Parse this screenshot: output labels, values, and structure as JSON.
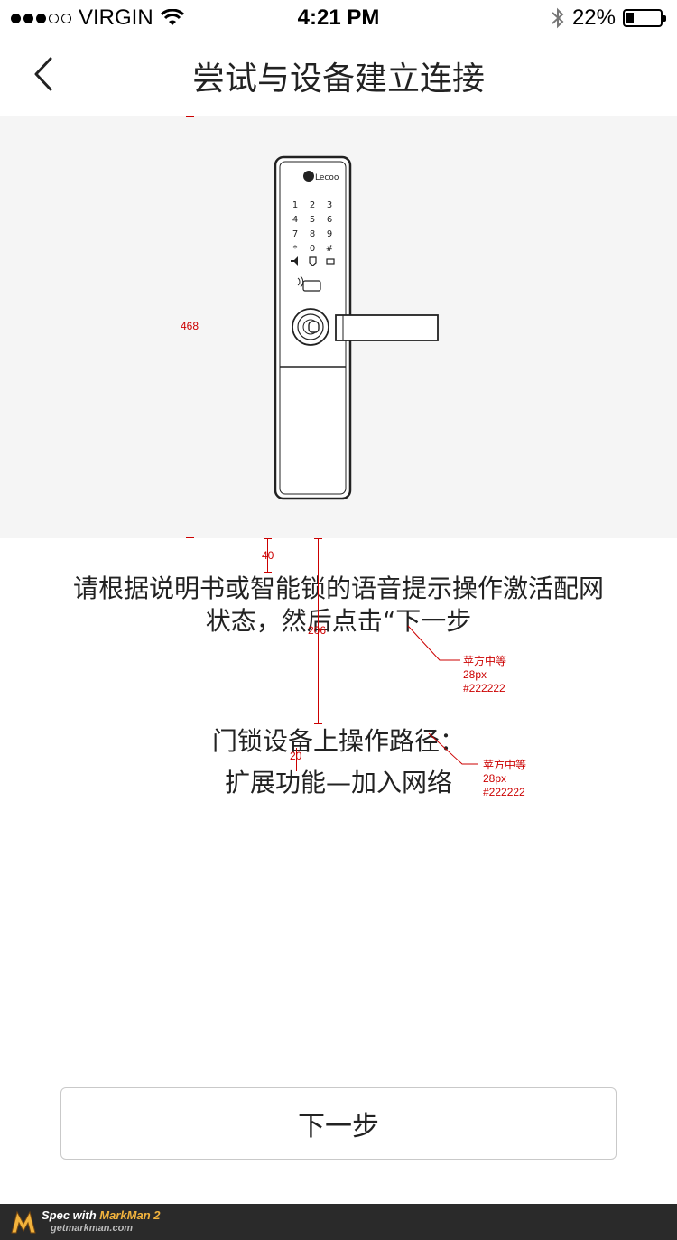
{
  "status_bar": {
    "carrier": "VIRGIN",
    "time": "4:21 PM",
    "battery": "22%",
    "battery_level": 0.22,
    "signal_bars_filled": 3,
    "signal_bars_total": 5
  },
  "nav": {
    "title": "尝试与设备建立连接",
    "back_icon": "chevron-left-icon"
  },
  "lock": {
    "brand": "Lecoo",
    "keypad": [
      "1",
      "2",
      "3",
      "4",
      "5",
      "6",
      "7",
      "8",
      "9",
      "*",
      "0",
      "#"
    ]
  },
  "instructions": {
    "line1": "请根据说明书或智能锁的语音提示操作激活配网",
    "line2": "状态，然后点击“下一步",
    "path_title": "门锁设备上操作路径：",
    "path_value": "扩展功能—加入网络"
  },
  "annotations": {
    "hero_height": "468",
    "gap_top": "40",
    "gap_block": "206",
    "gap_lines": "20",
    "note1": {
      "font": "苹方中等",
      "size": "28px",
      "color": "#222222"
    },
    "note2": {
      "font": "苹方中等",
      "size": "28px",
      "color": "#222222"
    }
  },
  "button": {
    "next_label": "下一步"
  },
  "footer": {
    "spec_prefix": "Spec with ",
    "brand": "MarkMan 2",
    "url": "getmarkman.com"
  },
  "colors": {
    "text": "#222222",
    "hero_bg": "#f5f5f5",
    "annotation": "#cc0000",
    "footer_bg": "#2a2a2a"
  }
}
